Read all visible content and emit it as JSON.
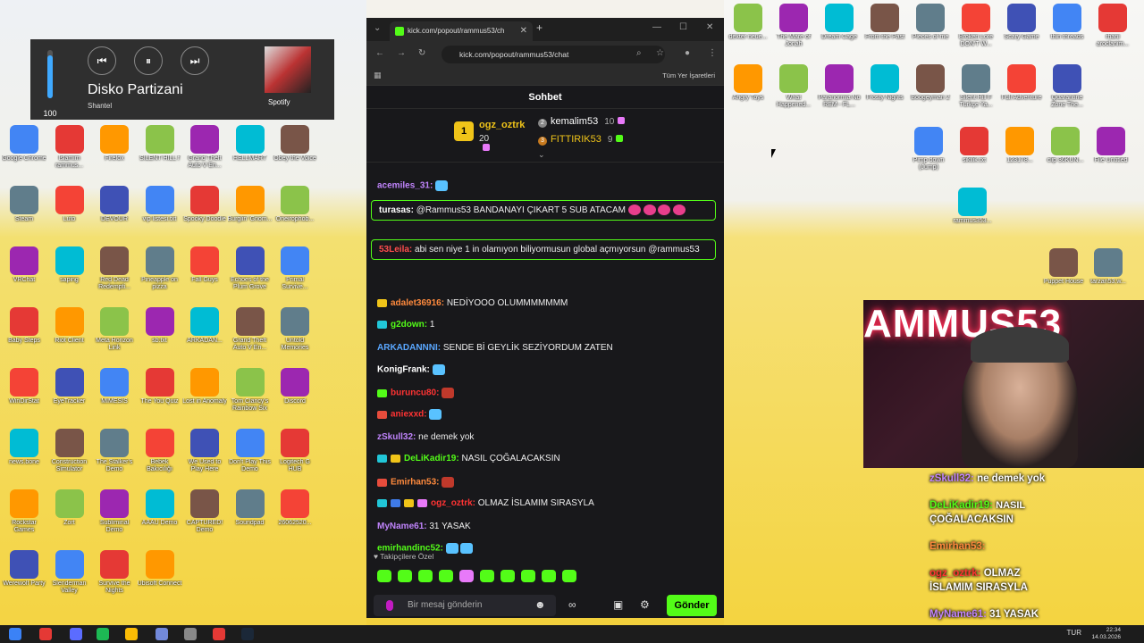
{
  "media": {
    "volume": "100",
    "title": "Disko Partizani",
    "artist": "Shantel",
    "source": "Spotify"
  },
  "browser": {
    "tab_title": "kick.com/popout/rammus53/ch",
    "url": "kick.com/popout/rammus53/chat",
    "bookmarks_label": "Tüm Yer İşaretleri"
  },
  "chat": {
    "header": "Sohbet",
    "leaders": {
      "first_name": "ogz_oztrk",
      "first_count": "20",
      "second_name": "kemalim53",
      "second_count": "10",
      "third_name": "FITTIRIK53",
      "third_count": "9"
    },
    "messages": [
      {
        "user": "acemiles_31:",
        "text": ""
      },
      {
        "user": "turasas:",
        "text": "@Rammus53 BANDANAYI ÇIKART 5 SUB ATACAM"
      },
      {
        "user": "53Leila:",
        "text": "abi sen niye 1 in olamıyon biliyormusun global açmıyorsun @rammus53"
      },
      {
        "user": "adalet36916:",
        "text": "NEDİYOOO OLUMMMMMMM"
      },
      {
        "user": "g2down:",
        "text": "1"
      },
      {
        "user": "ARKADANNNI:",
        "text": "SENDE Bİ GEYLİK SEZİYORDUM ZATEN"
      },
      {
        "user": "KonigFrank:",
        "text": ""
      },
      {
        "user": "buruncu80:",
        "text": ""
      },
      {
        "user": "aniexxd:",
        "text": ""
      },
      {
        "user": "zSkull32:",
        "text": "ne demek yok"
      },
      {
        "user": "DeLiKadir19:",
        "text": "NASIL ÇOĞALACAKSIN"
      },
      {
        "user": "Emirhan53:",
        "text": ""
      },
      {
        "user": "ogz_oztrk:",
        "text": "OLMAZ İSLAMIM SIRASYLA"
      },
      {
        "user": "MyName61:",
        "text": "31 YASAK"
      },
      {
        "user": "emirhandinc52:",
        "text": ""
      }
    ],
    "subscribers_label": "Takipçilere Özel",
    "input_placeholder": "Bir mesaj gönderin",
    "send_label": "Gönder"
  },
  "overlay": {
    "sign_text": "AMMUS53",
    "messages": [
      {
        "user": "zSkull32:",
        "text": "ne demek yok"
      },
      {
        "user": "DeLiKadir19:",
        "text": "NASIL ÇOĞALACAKSIN"
      },
      {
        "user": "Emirhan53:",
        "text": ""
      },
      {
        "user": "ogz_oztrk:",
        "text": "OLMAZ İSLAMIM SIRASYLA"
      },
      {
        "user": "MyName61:",
        "text": "31 YASAK"
      }
    ]
  },
  "desktop_icons_left": [
    "Google Chrome",
    "İslamim rammus...",
    "Firefox",
    "SILENT HILL f",
    "Grand Theft Auto V En...",
    "HELLMART",
    "Obey the Voice",
    "Steam",
    "Luto",
    "DEVOUR",
    "vip listesi.txt",
    "Spooky Doodle",
    "Burglin' Gnom...",
    "Oneirophob...",
    "VRChat",
    "saping",
    "Red Dead Redempti...",
    "Pineapple on pizza",
    "Fall Guys",
    "Echoes of the Plum Grove",
    "Primal Survive...",
    "Baby Steps",
    "Riot Client",
    "Meta Horizon Link",
    "sb.txt",
    "ARKADAN...",
    "Grand Theft Auto V En...",
    "Untold Memories",
    "WinDirStat",
    "EyeTracker",
    "MIMESIS",
    "The You Quiz",
    "Lost in Anomaly",
    "Tom Clancy's Rainbow Six",
    "Discord",
    "news.bone",
    "Construction Simulator",
    "The Stalker's Demo",
    "Bebek Bakıcılığı",
    "We Used to Play Here",
    "Don't Play This Demo",
    "Logitech G HUB",
    "Rockstar Games",
    "Zort",
    "Subliminal Demo",
    "AAAU Demo",
    "CAPTURED! Demo",
    "Soundpad",
    "26062520...",
    "Werewolf Party",
    "Slenderman Valley",
    "Survive the Nights",
    "Ubisoft Connect"
  ],
  "desktop_icons_right": [
    "dexter neue...",
    "The Mare of Jonah",
    "Dream Cage",
    "From the Past",
    "Pieces of me",
    "Broken Lore DON'T W...",
    "Scary Game",
    "thin threads",
    "rhani aroclanim...",
    "Angry Toys",
    "What Happened...",
    "Paranormia No REM - FL...",
    "Frosty Nights",
    "Boogeyman 2",
    "Silent Hill F Türkçe Ya...",
    "Full Adventure",
    "Quarantine Zone The...",
    "Pimp down (Jump)",
    "sikilik.txt",
    "123178...",
    "clip 36KUN...",
    "File Untitled",
    "rammus353...",
    "Puppet House",
    "tarzan53.w..."
  ],
  "taskbar": {
    "lang": "TUR",
    "time": "22:34",
    "date": "14.03.2026"
  }
}
